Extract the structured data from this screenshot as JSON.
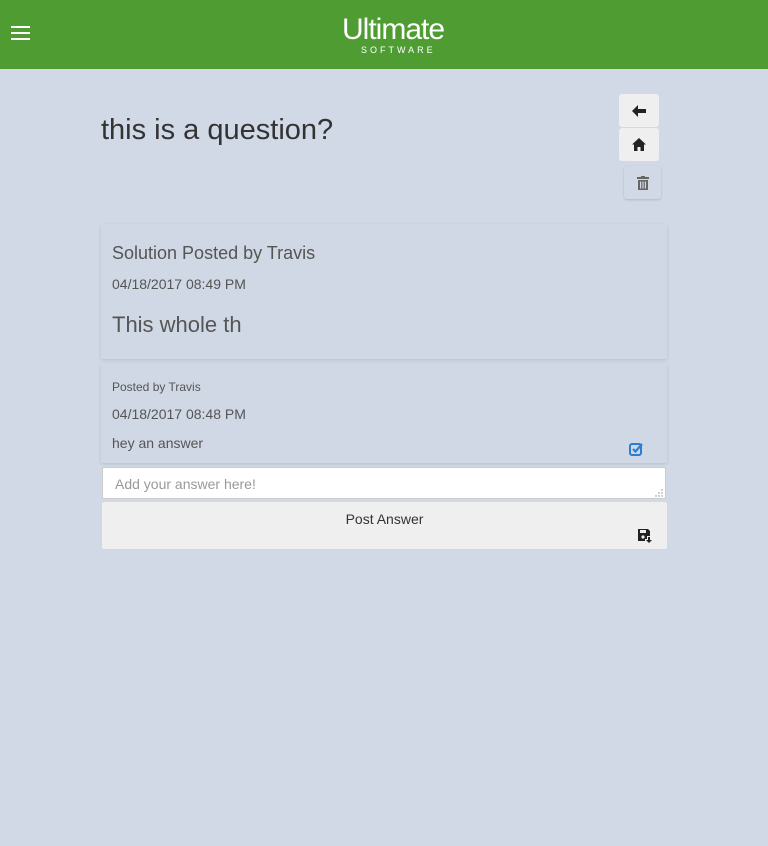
{
  "header": {
    "menu_icon": "hamburger-icon",
    "logo_brand": "Ultimate",
    "logo_sub": "SOFTWARE",
    "bar_color": "#4f9d32"
  },
  "question": {
    "title": "this is a question?"
  },
  "actions": {
    "back_icon": "arrow-left-icon",
    "home_icon": "home-icon",
    "delete_icon": "trash-icon"
  },
  "solution": {
    "heading": "Solution Posted by Travis",
    "date": "04/18/2017 08:49 PM",
    "body": "This whole th"
  },
  "answers": [
    {
      "posted_by": "Posted by Travis",
      "date": "04/18/2017 08:48 PM",
      "body": "hey an answer",
      "accept_icon": "checkbox-checked-icon",
      "accent": "#2a7fd4"
    }
  ],
  "compose": {
    "placeholder": "Add your answer here!",
    "value": "",
    "submit_label": "Post Answer",
    "submit_icon": "save-icon"
  }
}
